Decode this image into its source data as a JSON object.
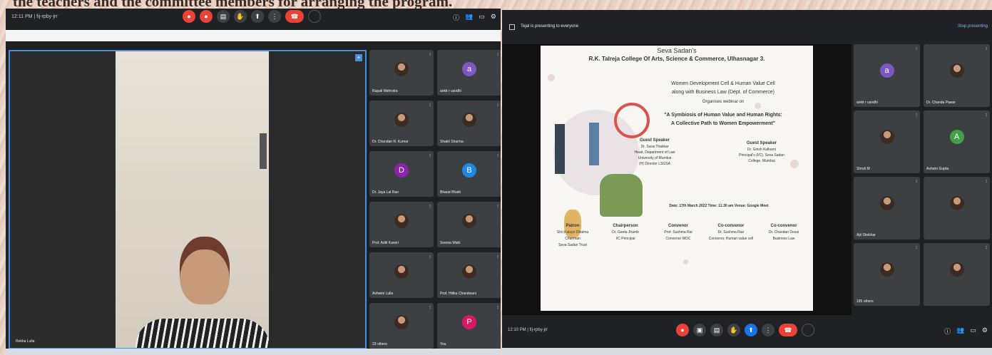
{
  "caption": "the teachers and the committee members for arranging the program.",
  "left": {
    "time": "12:11 PM | fij-rpby-jrr",
    "main_speaker": "Rekha Lulla",
    "tiles": [
      {
        "name": "Rupali Mehrotra",
        "type": "photo"
      },
      {
        "name": "ankit r usndhi",
        "type": "letter",
        "letter": "a",
        "color": "#7e57c2"
      },
      {
        "name": "Dr. Chandan R. Kumar",
        "type": "photo"
      },
      {
        "name": "Shakti Sharma",
        "type": "photo"
      },
      {
        "name": "Dr. Jaya Lal Rao",
        "type": "letter",
        "letter": "D",
        "color": "#8e24aa"
      },
      {
        "name": "Bharat Bhatti",
        "type": "letter",
        "letter": "B",
        "color": "#1e88e5"
      },
      {
        "name": "Prof. Aditi Kaveri",
        "type": "photo"
      },
      {
        "name": "Seema Wahi",
        "type": "photo"
      },
      {
        "name": "Ashwini Lulla",
        "type": "photo"
      },
      {
        "name": "Prof. Hitika Chandwani",
        "type": "photo"
      },
      {
        "name": "23 others",
        "type": "photo"
      },
      {
        "name": "You",
        "type": "letter",
        "letter": "P",
        "color": "#d81b60"
      }
    ]
  },
  "right": {
    "title": "Tejal is presenting to everyone",
    "stop_label": "Stop presenting",
    "time": "12:10 PM | fij-rpby-jrr",
    "poster": {
      "l1": "Seva Sadan's",
      "l2": "R.K. Talreja College Of Arts, Science & Commerce, Ulhasnagar 3.",
      "l3": "Women Development Cell & Human Value Cell",
      "l4": "along with Business Law (Dept. of Commerce)",
      "l5": "Organises webinar on",
      "l6": "\"A Symbiosis of Human Value and Human Rights:",
      "l7": "A Collective Path to Women Empowerment\"",
      "gs_head": "Guest Speaker",
      "gs1": "Dr. Sarai Thakkar",
      "gs2": "Head, Department of Law",
      "gs3": "University of Mumbai",
      "gs4": "(H) Director LSGSA",
      "gs5_head": "Guest Speaker",
      "gs6": "Dr. Girish Kulkarni",
      "gs7": "Principal's (I/C), Seva Sadan",
      "gs8": "College, Mumbai",
      "date": "Date: 17th March 2022     Time: 11:30 am     Venue: Google Meet",
      "roles": [
        {
          "h": "Patron",
          "a": "Shri Kalayo Dhaima",
          "b": "Chairman",
          "c": "Seva Sadan Trust"
        },
        {
          "h": "Chairperson",
          "a": "Dr. Geeta Jhamb",
          "b": "I/C Principal",
          "c": ""
        },
        {
          "h": "Convenor",
          "a": "Prof. Sushma Rai",
          "b": "Convenor WDC",
          "c": ""
        },
        {
          "h": "Co-convenor",
          "a": "Dr. Sushma Rao",
          "b": "Convenor, Human value cell",
          "c": ""
        },
        {
          "h": "Co-convenor",
          "a": "Dr. Chandan Desai",
          "b": "Business Law",
          "c": ""
        }
      ]
    },
    "tiles": [
      {
        "name": "ankit r usndhi",
        "type": "letter",
        "letter": "a",
        "color": "#7e57c2"
      },
      {
        "name": "Dr. Chanda Pawar",
        "type": "photo"
      },
      {
        "name": "Shruti M",
        "type": "photo"
      },
      {
        "name": "Ashwin Gupta",
        "type": "letter",
        "letter": "A",
        "color": "#43a047"
      },
      {
        "name": "Ajit Shekhar",
        "type": "photo"
      },
      {
        "name": "",
        "type": "photo"
      },
      {
        "name": "185 others",
        "type": "photo"
      },
      {
        "name": "",
        "type": "photo"
      }
    ]
  }
}
